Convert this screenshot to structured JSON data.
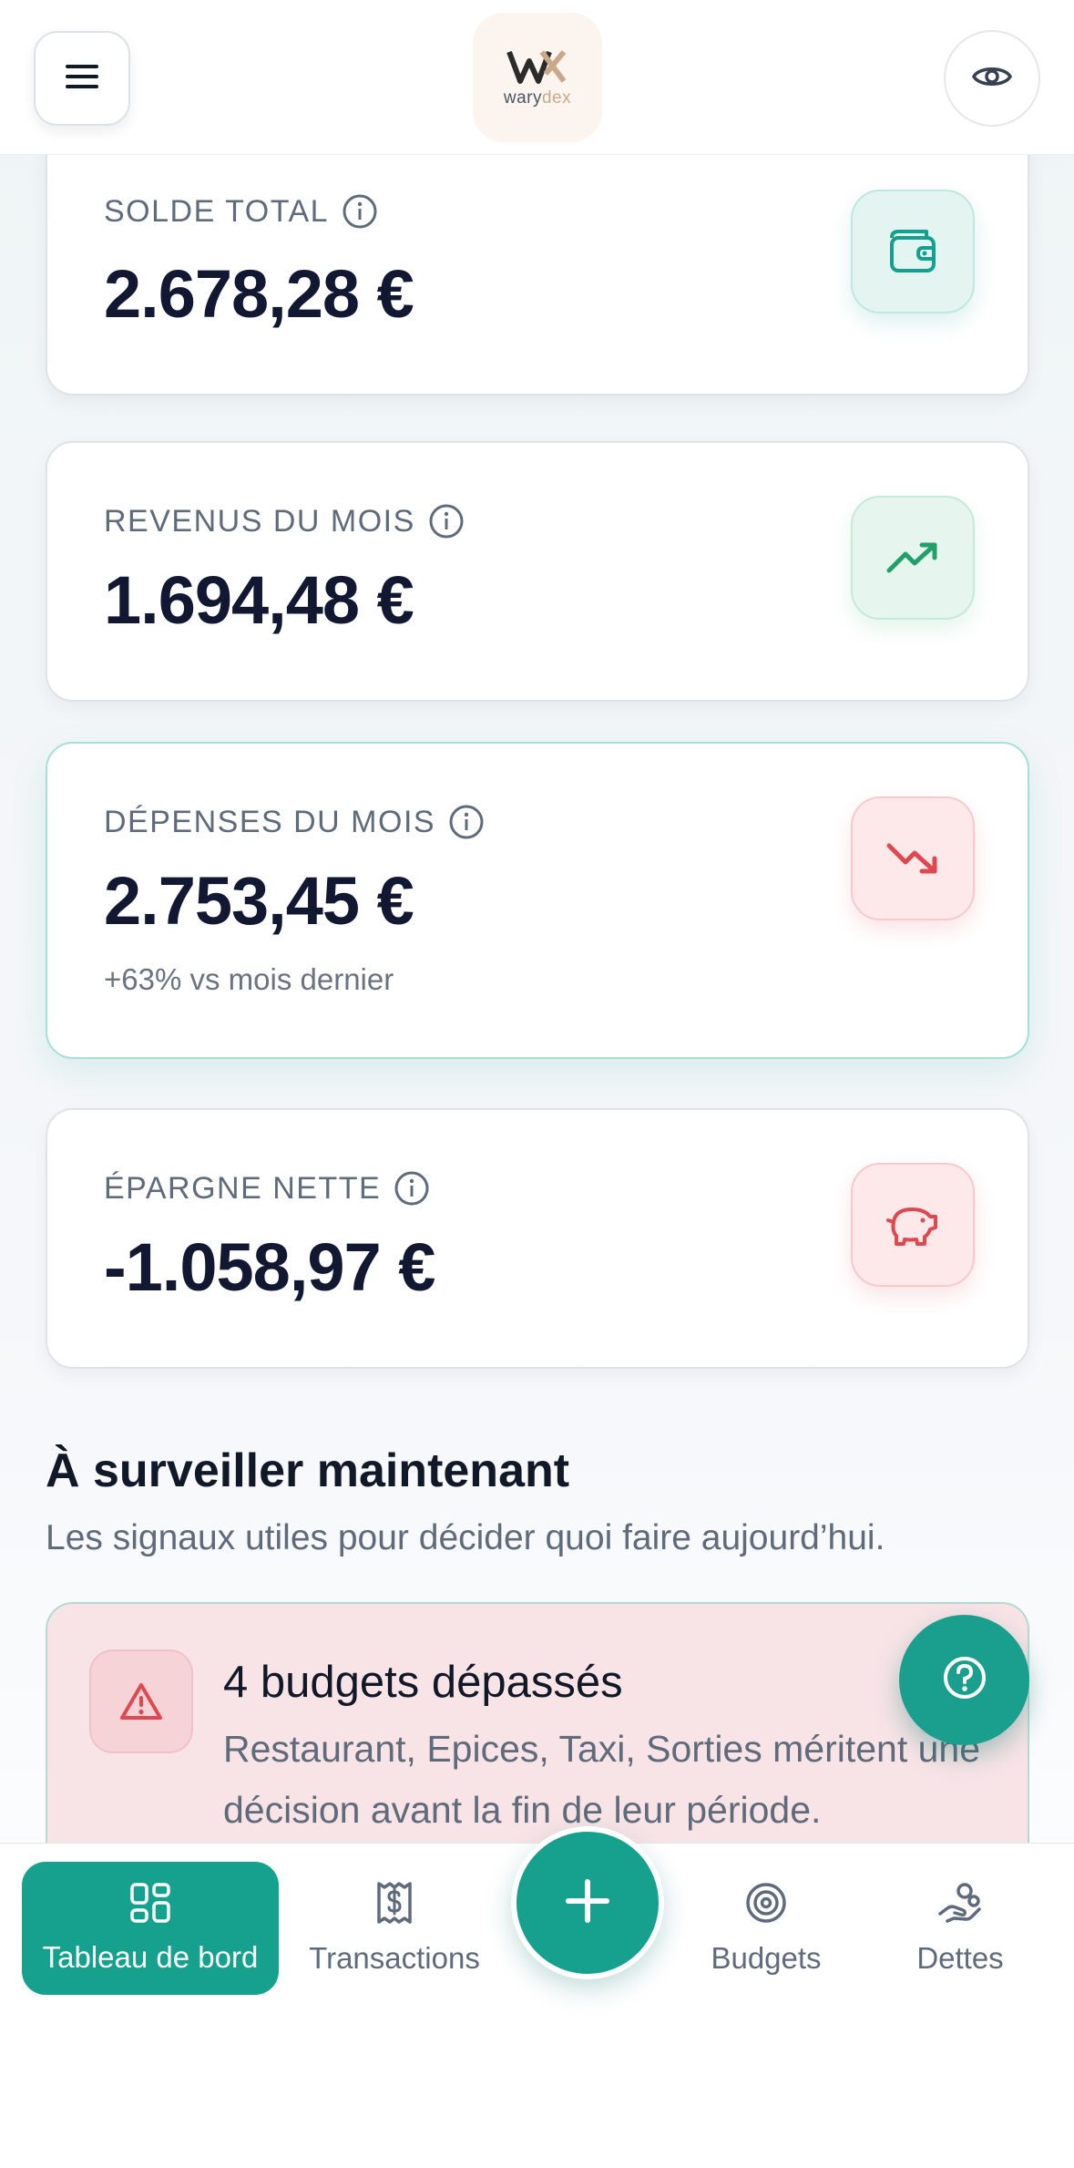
{
  "header": {
    "logo_text_main": "wary",
    "logo_text_accent": "dex"
  },
  "cards": [
    {
      "label": "SOLDE TOTAL",
      "value": "2.678,28 €",
      "icon": "wallet-icon",
      "color": "#14a08e"
    },
    {
      "label": "REVENUS DU MOIS",
      "value": "1.694,48 €",
      "icon": "trending-up-icon",
      "color": "#22a06b"
    },
    {
      "label": "DÉPENSES DU MOIS",
      "value": "2.753,45 €",
      "sub": "+63% vs mois dernier",
      "icon": "trending-down-icon",
      "color": "#e04850"
    },
    {
      "label": "ÉPARGNE NETTE",
      "value": "-1.058,97 €",
      "icon": "piggy-bank-icon",
      "color": "#e04850"
    }
  ],
  "watch": {
    "title": "À surveiller maintenant",
    "subtitle": "Les signaux utiles pour décider quoi faire aujourd’hui.",
    "alert": {
      "title": "4 budgets dépassés",
      "text": "Restaurant, Epices, Taxi, Sorties méritent une décision avant la fin de leur période.",
      "icon": "warning-icon"
    }
  },
  "nav": {
    "items": [
      {
        "label": "Tableau de bord",
        "icon": "dashboard-icon",
        "active": true
      },
      {
        "label": "Transactions",
        "icon": "receipt-icon",
        "active": false
      },
      {
        "label": "Budgets",
        "icon": "target-icon",
        "active": false
      },
      {
        "label": "Dettes",
        "icon": "hand-coins-icon",
        "active": false
      }
    ]
  },
  "colors": {
    "brand": "#16a08e",
    "danger": "#e04850",
    "success": "#22a06b"
  }
}
